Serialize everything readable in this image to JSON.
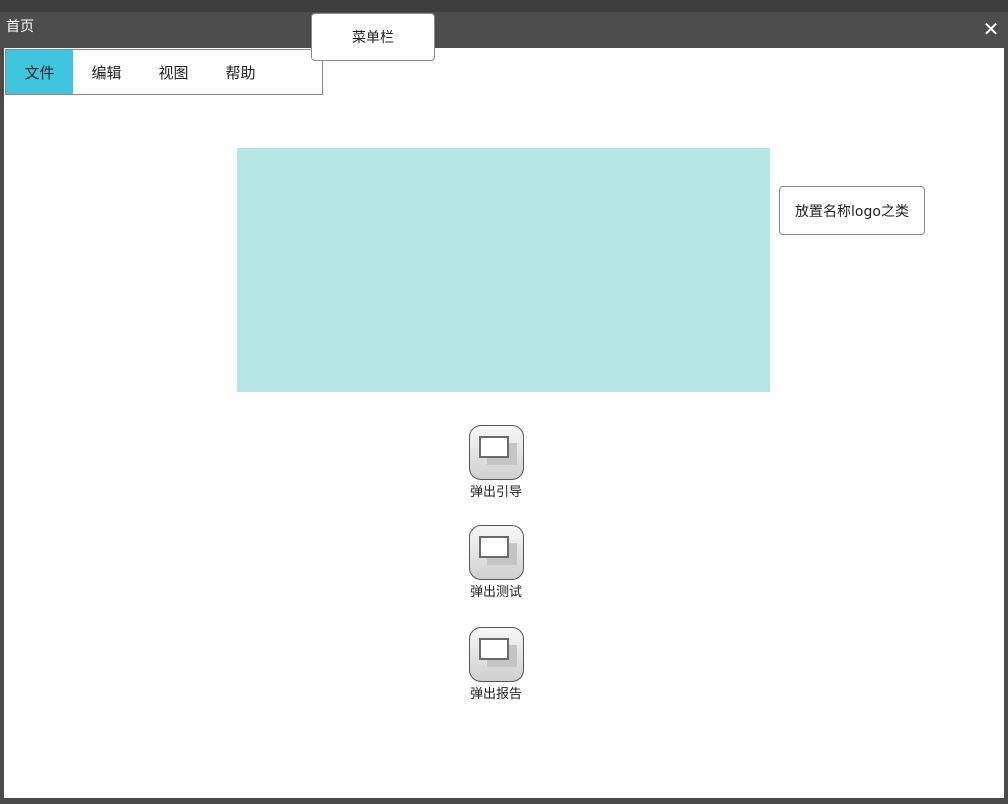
{
  "window": {
    "title": "首页",
    "close_icon": "close-icon",
    "close_glyph": "✕"
  },
  "menubar": {
    "items": [
      {
        "label": "文件",
        "active": true
      },
      {
        "label": "编辑",
        "active": false
      },
      {
        "label": "视图",
        "active": false
      },
      {
        "label": "帮助",
        "active": false
      }
    ],
    "callout": "菜单栏"
  },
  "banner": {
    "color": "#b5e6e5",
    "callout": "放置名称logo之类"
  },
  "launch_buttons": [
    {
      "label": "弹出引导",
      "icon": "window-icon"
    },
    {
      "label": "弹出测试",
      "icon": "window-icon"
    },
    {
      "label": "弹出报告",
      "icon": "window-icon"
    }
  ],
  "colors": {
    "titlebar": "#4d4d4d",
    "menu_active": "#3ec6df",
    "banner": "#b5e6e5"
  }
}
